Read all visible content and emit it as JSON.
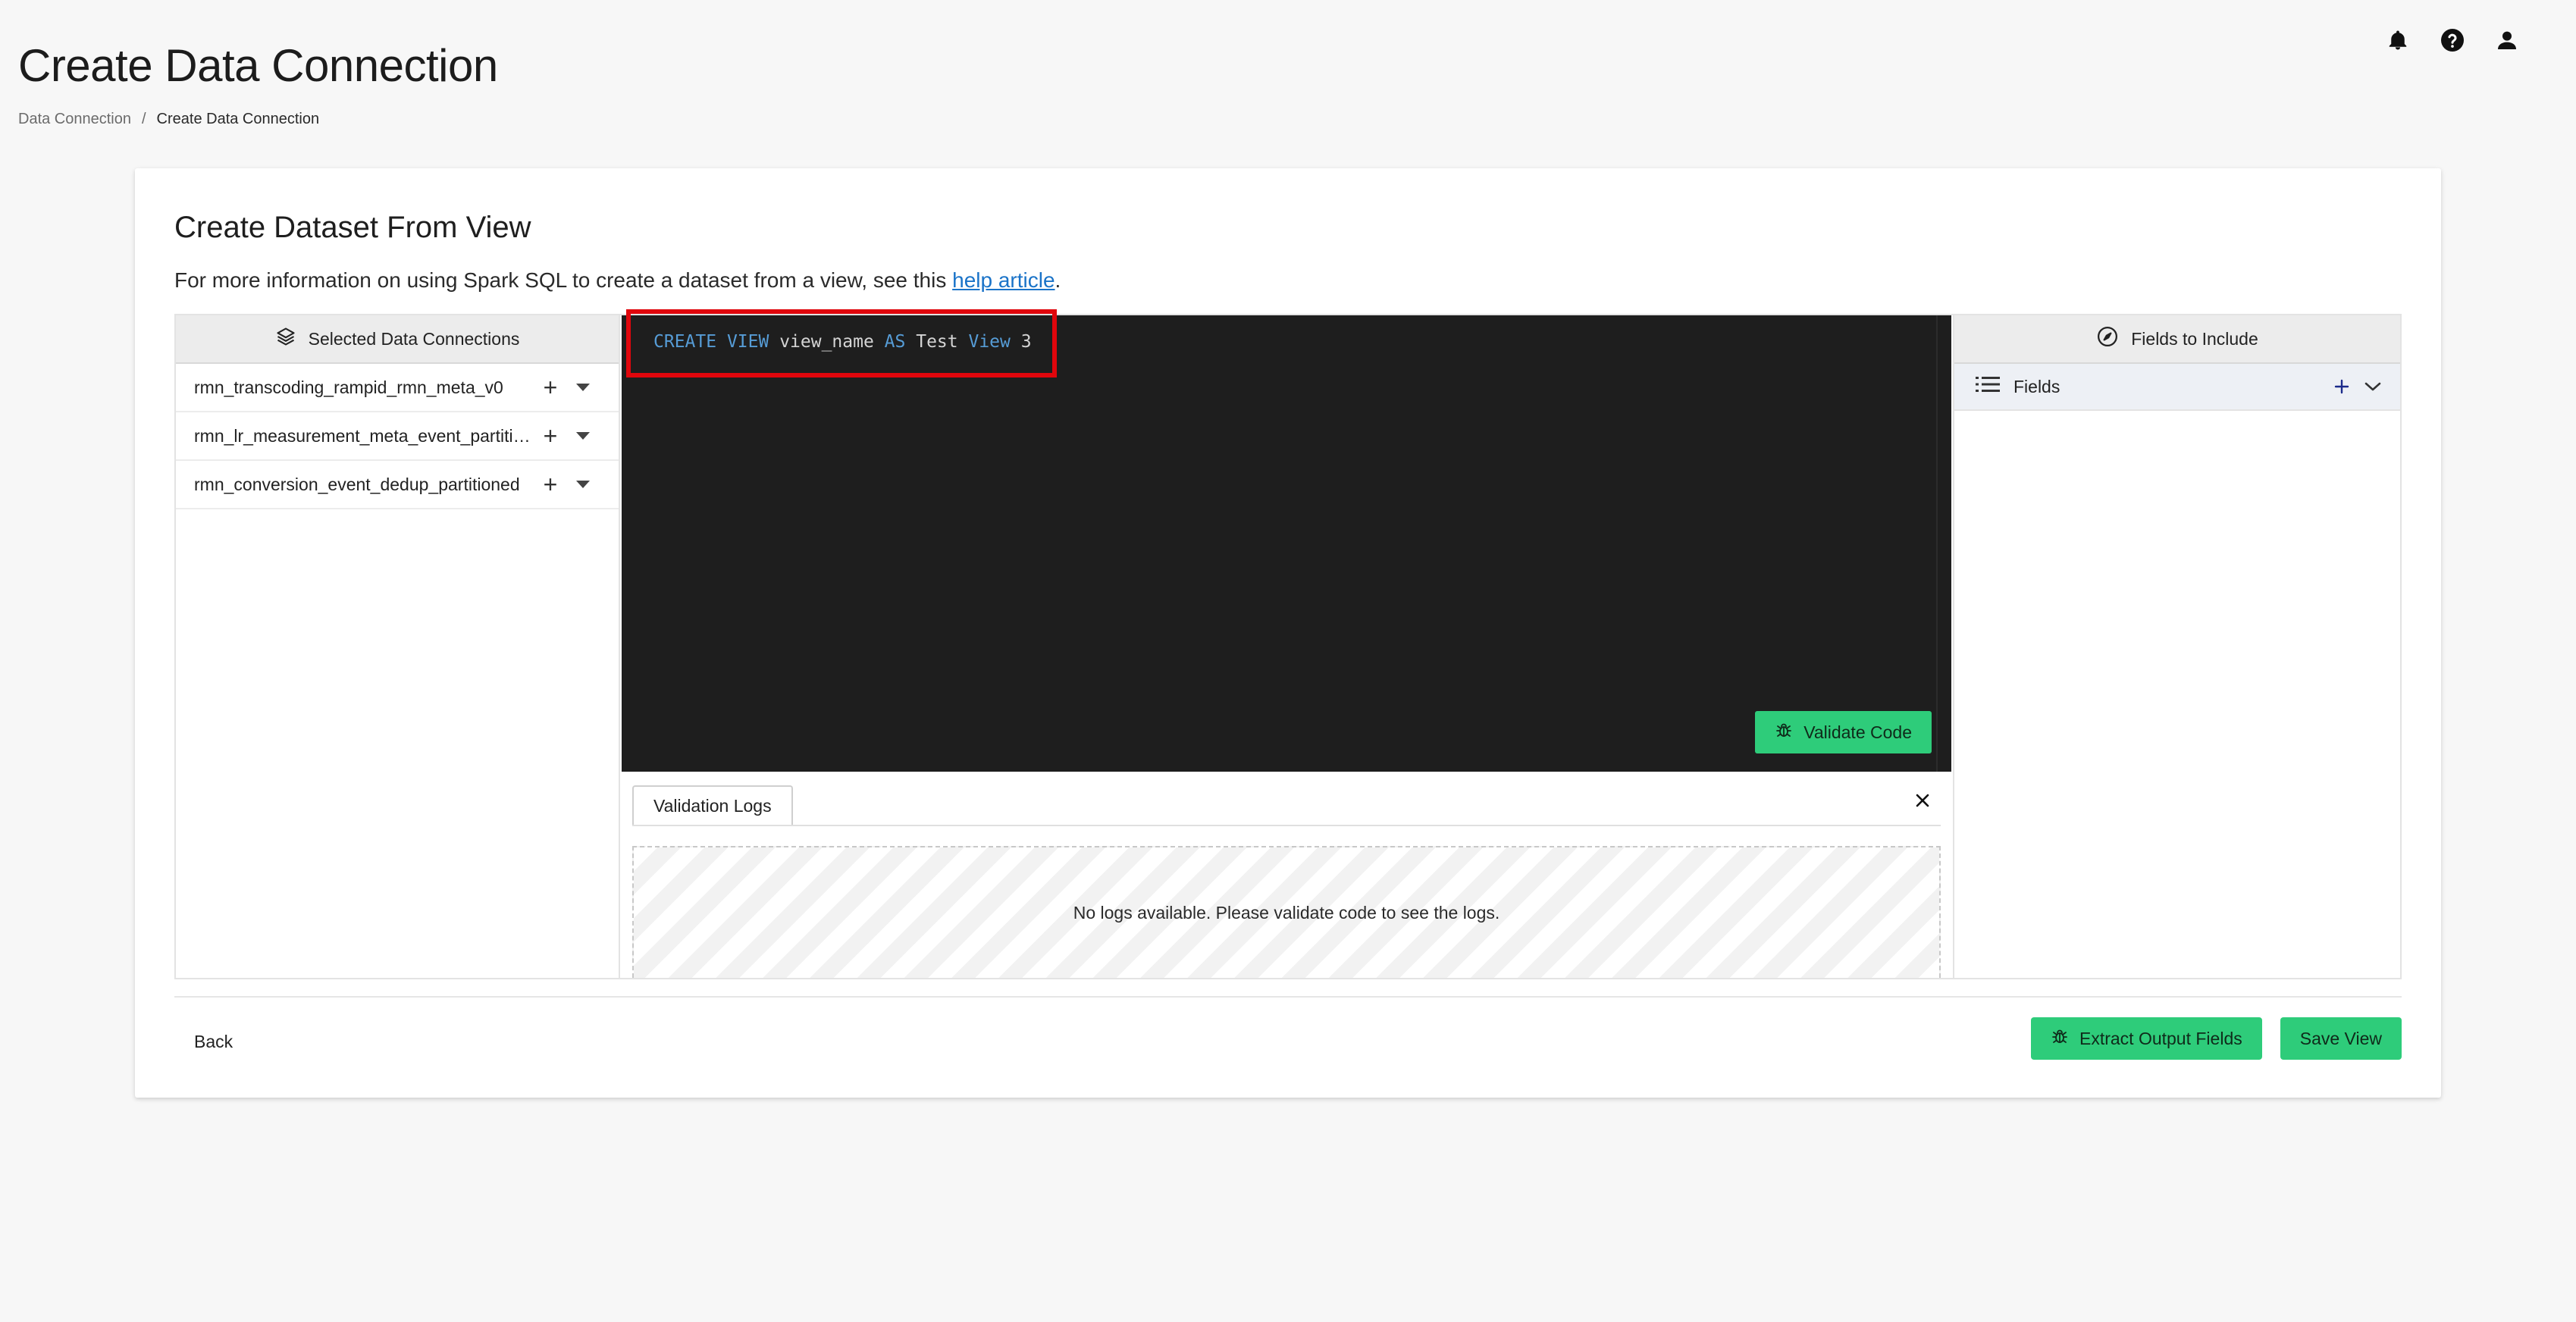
{
  "header": {
    "title": "Create Data Connection",
    "breadcrumb": {
      "parent": "Data Connection",
      "separator": "/",
      "current": "Create Data Connection"
    },
    "icons": [
      "bell-icon",
      "help-icon",
      "user-icon"
    ]
  },
  "card": {
    "title": "Create Dataset From View",
    "description_prefix": "For more information on using Spark SQL to create a dataset from a view, see this ",
    "help_link": "help article",
    "description_suffix": "."
  },
  "left_panel": {
    "header": "Selected Data Connections",
    "items": [
      {
        "label": "rmn_transcoding_rampid_rmn_meta_v0"
      },
      {
        "label": "rmn_lr_measurement_meta_event_partitioned"
      },
      {
        "label": "rmn_conversion_event_dedup_partitioned"
      }
    ]
  },
  "editor": {
    "code": {
      "kw1": "CREATE",
      "kw2": "VIEW",
      "t1": " view_name ",
      "kw3": "AS",
      "t2": " Test ",
      "kw4": "View",
      "t3": " 3"
    },
    "validate_label": "Validate Code"
  },
  "logs": {
    "tab_label": "Validation Logs",
    "empty_message": "No logs available. Please validate code to see the logs."
  },
  "right_panel": {
    "header": "Fields to Include",
    "fields_label": "Fields"
  },
  "footer": {
    "back_label": "Back",
    "extract_label": "Extract Output Fields",
    "save_label": "Save View"
  },
  "colors": {
    "accent_green": "#2ecc7a",
    "editor_bg": "#1e1e1e",
    "keyword": "#569cd6",
    "highlight": "#e0060c",
    "link": "#1a73c8"
  }
}
